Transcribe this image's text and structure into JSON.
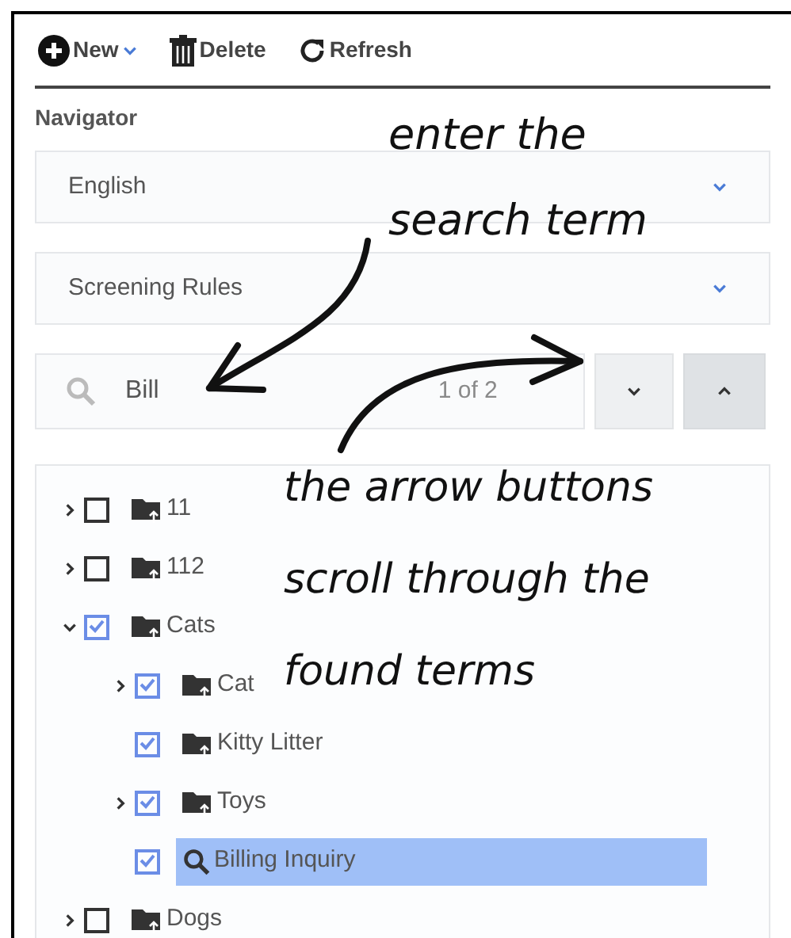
{
  "toolbar": [
    {
      "kind": "new",
      "label": "New"
    },
    {
      "kind": "delete",
      "label": "Delete"
    },
    {
      "kind": "refresh",
      "label": "Refresh"
    }
  ],
  "navigator": {
    "title": "Navigator",
    "dropdowns": [
      {
        "value": "English"
      },
      {
        "value": "Screening Rules"
      }
    ]
  },
  "search": {
    "value": "Bill",
    "counter": "1 of 2"
  },
  "tree": [
    {
      "label": "11",
      "kind": "folder",
      "expandable": true,
      "expanded": false,
      "checked": false,
      "selected": false
    },
    {
      "label": "112",
      "kind": "folder",
      "expandable": true,
      "expanded": false,
      "checked": false,
      "selected": false
    },
    {
      "label": "Cats",
      "kind": "folder",
      "expandable": true,
      "expanded": true,
      "checked": true,
      "selected": false,
      "children": [
        {
          "label": "Cat",
          "kind": "folder",
          "expandable": true,
          "expanded": false,
          "checked": true,
          "selected": false
        },
        {
          "label": "Kitty Litter",
          "kind": "folder",
          "expandable": false,
          "expanded": false,
          "checked": true,
          "selected": false
        },
        {
          "label": "Toys",
          "kind": "folder",
          "expandable": true,
          "expanded": false,
          "checked": true,
          "selected": false
        },
        {
          "label": "Billing Inquiry",
          "kind": "search",
          "expandable": false,
          "expanded": false,
          "checked": true,
          "selected": true
        }
      ]
    },
    {
      "label": "Dogs",
      "kind": "folder",
      "expandable": true,
      "expanded": false,
      "checked": false,
      "selected": false
    }
  ],
  "annotations": [
    {
      "lines": [
        "enter the",
        "search term"
      ]
    },
    {
      "lines": [
        "the arrow buttons",
        "scroll through the",
        "found terms"
      ]
    }
  ]
}
